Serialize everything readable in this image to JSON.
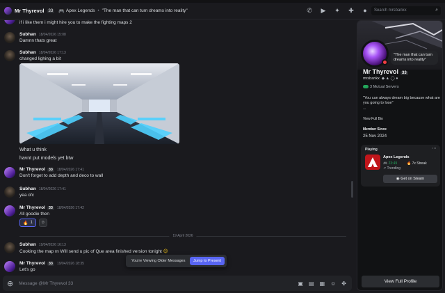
{
  "topbar": {
    "user_name": "Mr Thyrevol",
    "user_tag": "33",
    "game_name": "Apex Legends",
    "separator": "•",
    "status_text": "\"The man that can turn dreams into reality\"",
    "search_placeholder": "Search mrsbankx"
  },
  "messages": [
    {
      "author": "",
      "time": "",
      "text": "if i like them i might hire you to make the fighting maps 2"
    },
    {
      "author": "Subhan",
      "time": "18/04/2026 15:08",
      "text": "Damnn thats great"
    },
    {
      "author": "Subhan",
      "time": "18/04/2026 17:13",
      "text": "changed lighing a bit",
      "text2": "What u think",
      "text3": "havnt put models yet btw"
    },
    {
      "author": "Mr Thyrevol",
      "tag": "33",
      "time": "18/04/2026 17:41",
      "text": "Don't forget to add depth and deco to wall"
    },
    {
      "author": "Subhan",
      "time": "18/04/2026 17:41",
      "text": "yea ofc"
    },
    {
      "author": "Mr Thyrevol",
      "tag": "33",
      "time": "18/04/2026 17:42",
      "text": "All goodie then"
    },
    {
      "author": "Subhan",
      "time": "19/04/2026 16:13",
      "text": "Cooking the map rn Will send u pic of Que area finished version tonight"
    },
    {
      "author": "Mr Thyrevol",
      "tag": "33",
      "time": "19/04/2026 18:35",
      "text": "Let's go"
    }
  ],
  "reaction": {
    "count": "1"
  },
  "date_divider": "19 April 2026",
  "older_banner": {
    "text": "You're Viewing Older Messages",
    "button": "Jump to Present"
  },
  "composer": {
    "placeholder": "Message @Mr Thyrevol 33"
  },
  "profile": {
    "bubble": "\"The man that can turn dreams into reality\"",
    "name": "Mr Thyrevol",
    "tag": "33",
    "username": "mrsbankx",
    "mutual": "3 Mutual Servers",
    "bio": "\"You can always dream big because what are you going to lose\"",
    "bio_ellipsis": "...",
    "view_bio": "View Full Bio",
    "member_since_label": "Member Since",
    "member_since_value": "25 Nov 2024",
    "playing_label": "Playing",
    "game": "Apex Legends",
    "game_time": "23:49",
    "streak": "7x Streak",
    "trending": "Trending",
    "steam_button": "Get on Steam",
    "view_full_profile": "View Full Profile"
  }
}
